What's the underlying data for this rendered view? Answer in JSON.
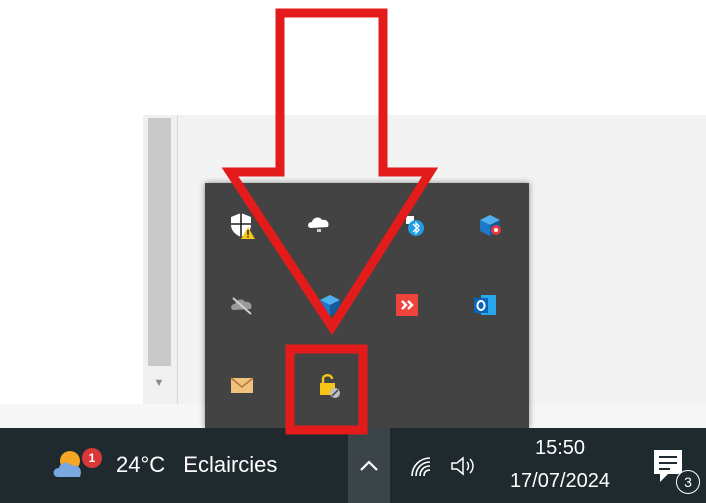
{
  "taskbar": {
    "weather": {
      "icon": "weather-partly-cloudy-icon",
      "badge_count": "1",
      "temperature": "24°C",
      "condition": "Eclaircies"
    },
    "overflow_chevron_icon": "chevron-up-icon",
    "system_icons": [
      "network-icon",
      "speaker-icon"
    ],
    "clock": {
      "time": "15:50",
      "date": "17/07/2024"
    },
    "notifications": {
      "icon": "notification-center-icon",
      "count": "3"
    }
  },
  "tray_flyout": {
    "icons": [
      "windows-security-warning-icon",
      "onedrive-icon",
      "bluetooth-device-icon",
      "network-drive-icon",
      "cloud-offline-icon",
      "dropbox-icon",
      "anydesk-icon",
      "outlook-icon",
      "mail-icon",
      "lock-blocked-icon"
    ]
  },
  "annotation": {
    "color": "#e31b1b",
    "shape": "arrow-down-and-highlight-box"
  },
  "colors": {
    "taskbar": "#1f2a2f",
    "flyout": "#434343",
    "accent_red": "#e31b1b"
  }
}
